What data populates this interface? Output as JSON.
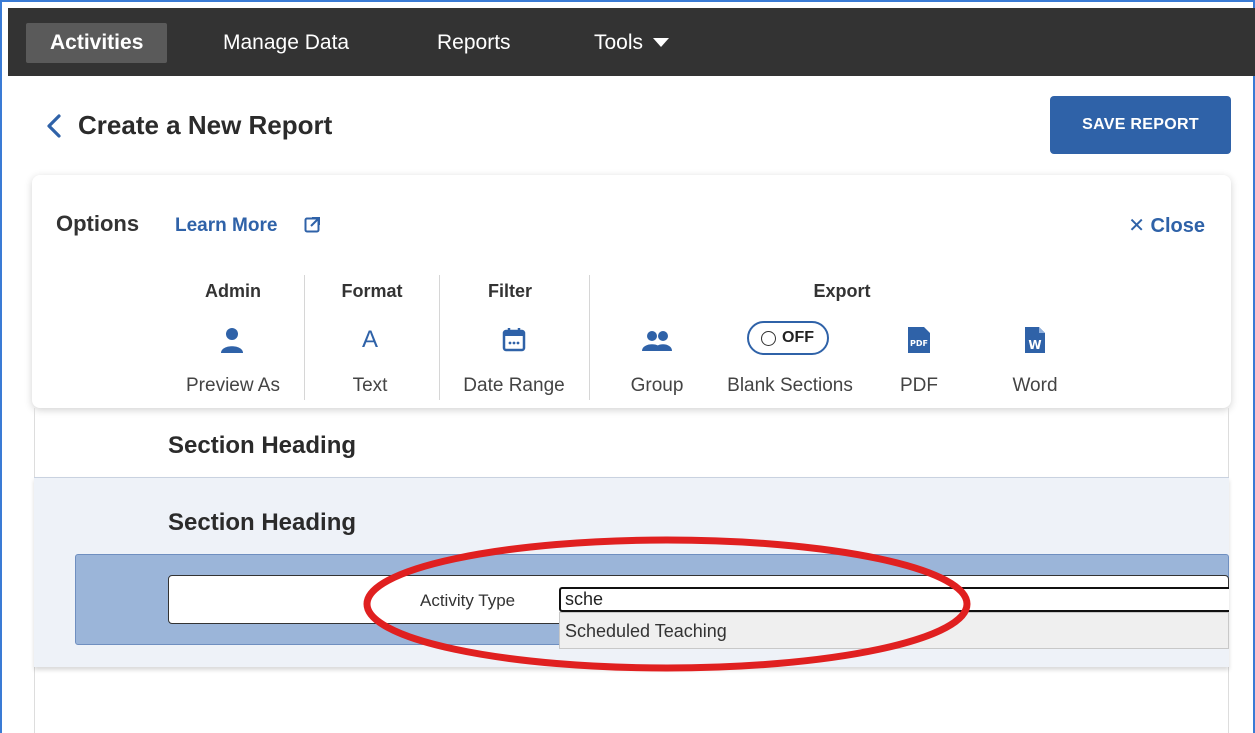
{
  "nav": {
    "items": [
      {
        "label": "Activities"
      },
      {
        "label": "Manage Data"
      },
      {
        "label": "Reports"
      },
      {
        "label": "Tools"
      }
    ]
  },
  "header": {
    "title": "Create a New Report",
    "save_label": "SAVE REPORT"
  },
  "options": {
    "title": "Options",
    "learn_more": "Learn More",
    "close_label": "Close",
    "groups": {
      "admin": "Admin",
      "format": "Format",
      "filter": "Filter",
      "export": "Export"
    },
    "tools": {
      "preview_as": "Preview As",
      "text": "Text",
      "date_range": "Date Range",
      "group": "Group",
      "blank_sections": "Blank Sections",
      "blank_sections_toggle": "OFF",
      "pdf": "PDF",
      "word": "Word"
    },
    "icon_glyphs": {
      "text": "A",
      "pdf": "PDF",
      "word": "W"
    }
  },
  "report": {
    "section_1_heading": "Section Heading",
    "section_2_heading": "Section Heading",
    "field_label": "Activity Type",
    "field_value": "sche",
    "suggestion": "Scheduled Teaching"
  },
  "colors": {
    "accent": "#2f62a8",
    "nav_bg": "#333333",
    "highlight_ring": "#e02020"
  }
}
